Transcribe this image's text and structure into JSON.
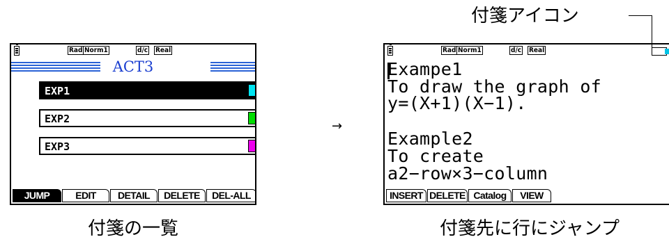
{
  "left_screen": {
    "status_badges": [
      "Rad",
      "Norm1",
      "d/c",
      "Real"
    ],
    "title": "ACT3",
    "items": [
      {
        "label": "EXP1",
        "color": "#00e5f2",
        "selected": true
      },
      {
        "label": "EXP2",
        "color": "#00dd00",
        "selected": false
      },
      {
        "label": "EXP3",
        "color": "#ee00ee",
        "selected": false
      }
    ],
    "function_keys": [
      "JUMP",
      "EDIT",
      "DETAIL",
      "DELETE",
      "DEL-ALL"
    ],
    "caption": "付箋の一覧"
  },
  "arrow": "→",
  "right_screen": {
    "status_badges": [
      "Rad",
      "Norm1",
      "d/c",
      "Real"
    ],
    "sticky_icon_color": "#00c3e6",
    "lines": [
      "Exampe1",
      "To draw the graph of",
      "y=(X+1)(X−1).",
      "",
      "Example2",
      "To create",
      "a2−row×3−column"
    ],
    "function_keys": [
      "INSERT",
      "DELETE",
      "Catalog",
      "VIEW"
    ],
    "caption": "付箋先に行にジャンプ"
  },
  "callout": {
    "label": "付箋アイコン"
  }
}
